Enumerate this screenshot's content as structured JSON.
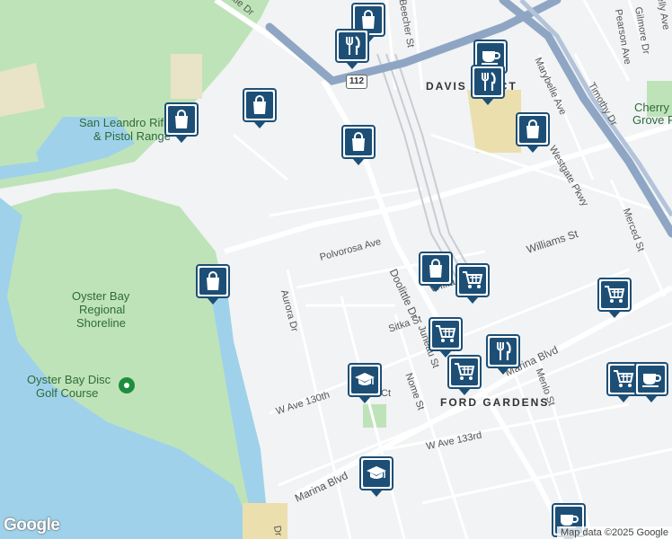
{
  "map": {
    "labels": {
      "san_leandro_rifle": "San Leandro Rifle",
      "pistol_range": "& Pistol Range",
      "oyster_bay_1": "Oyster Bay",
      "oyster_bay_2": "Regional",
      "oyster_bay_3": "Shoreline",
      "disc_golf_1": "Oyster Bay Disc",
      "disc_golf_2": "Golf Course",
      "davis_tract": "DAVIS TRACT",
      "cherry_grove": "Cherry",
      "cherry_grove_2": "Grove Park",
      "ford_gardens": "FORD GARDENS",
      "doolittle_top": "ttle Dr",
      "doolittle_dr": "Doolittle Dr",
      "polvorosa": "Polvorosa Ave",
      "aurora": "Aurora Dr",
      "williams_st": "Williams St",
      "williams_st_2": "Willia",
      "sitka": "Sitka St",
      "juneau": "Juneau St",
      "nome": "Nome St",
      "w_ave_130": "W Ave 130th",
      "w_ave_133": "W Ave 133rd",
      "marina_blvd": "Marina Blvd",
      "marina_blvd_2": "Marina Blvd",
      "menlo": "Menlo St",
      "merced": "Merced St",
      "westgate": "Westgate Pkwy",
      "marybelle": "Marybelle Ave",
      "timothy": "Timothy Dr",
      "pearson": "Pearson Ave",
      "gilmore": "Gilmore Dr",
      "kelly": "Kelly Ave",
      "beecher": "Beecher St",
      "highway_112": "112",
      "bottom_dr": "Dr",
      "ct": "Ct"
    },
    "attribution": "Map data ©2025 Google",
    "logo": "Google",
    "markers": [
      {
        "type": "shopping",
        "icon": "shopping-bag-icon"
      },
      {
        "type": "restaurant",
        "icon": "fork-knife-icon"
      },
      {
        "type": "cafe",
        "icon": "coffee-cup-icon"
      },
      {
        "type": "restaurant",
        "icon": "fork-knife-icon"
      },
      {
        "type": "shopping",
        "icon": "shopping-bag-icon"
      },
      {
        "type": "shopping",
        "icon": "shopping-bag-icon"
      },
      {
        "type": "shopping",
        "icon": "shopping-bag-icon"
      },
      {
        "type": "shopping",
        "icon": "shopping-bag-icon"
      },
      {
        "type": "shopping",
        "icon": "shopping-bag-icon"
      },
      {
        "type": "shopping",
        "icon": "shopping-bag-icon"
      },
      {
        "type": "grocery",
        "icon": "shopping-cart-icon"
      },
      {
        "type": "grocery",
        "icon": "shopping-cart-icon"
      },
      {
        "type": "grocery",
        "icon": "shopping-cart-icon"
      },
      {
        "type": "restaurant",
        "icon": "fork-knife-icon"
      },
      {
        "type": "grocery",
        "icon": "shopping-cart-icon"
      },
      {
        "type": "grocery",
        "icon": "shopping-cart-icon"
      },
      {
        "type": "cafe",
        "icon": "coffee-cup-icon"
      },
      {
        "type": "school",
        "icon": "graduation-cap-icon"
      },
      {
        "type": "school",
        "icon": "graduation-cap-icon"
      },
      {
        "type": "cafe",
        "icon": "coffee-cup-icon"
      }
    ],
    "colors": {
      "water": "#9fd2ea",
      "park": "#bfe3b9",
      "land": "#f1f3f4",
      "road": "#ffffff",
      "highway": "#8ea6c4",
      "marker": "#1d4f76"
    }
  }
}
